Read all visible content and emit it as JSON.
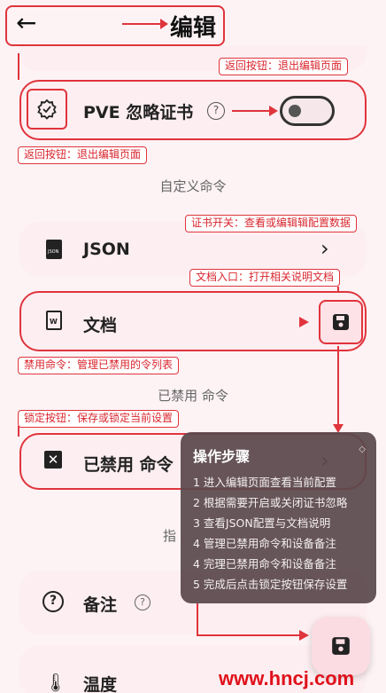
{
  "header": {
    "title": "编辑"
  },
  "callouts": {
    "back_button": "返回按钮：退出编辑页面",
    "back_button_2": "返回按钮：退出编辑页面",
    "cert_switch": "证书开关：查看或编辑辑配置数据",
    "doc_entry": "文档入口：打开相关说明文档",
    "disabled_cmds": "禁用命令：管理已禁用的令列表",
    "lock_button": "锁定按钮：保存或锁定当前设置"
  },
  "pve": {
    "label": "PVE 忽略证书",
    "help_icon": "?",
    "toggle_on": false
  },
  "sections": {
    "custom_commands": "自定义命令",
    "disabled_commands": "已禁用 命令",
    "partial": "指"
  },
  "rows": {
    "json": {
      "label": "JSON",
      "chevron": "›"
    },
    "doc": {
      "label": "文档"
    },
    "disabled": {
      "label": "已禁用 命令",
      "chevron": "›"
    },
    "notes": {
      "label": "备注",
      "help_icon": "?"
    },
    "temperature": {
      "label": "温度"
    }
  },
  "popup": {
    "title": "操作步骤",
    "steps": [
      "1 进入编辑页面查看当前配置",
      "2 根据需要开启或关闭证书忽略",
      "3 查看JSON配置与文档说明",
      "4 管理已禁用命令和设备备注",
      "4 完理已禁用命令和设备备注",
      "5 完成后点击锁定按钮保存设置"
    ]
  },
  "watermark": "www.hncj.com",
  "colors": {
    "accent": "#e0343c",
    "card": "#fdeef1",
    "background": "#fdf3f5",
    "popup": "#5a484c"
  }
}
